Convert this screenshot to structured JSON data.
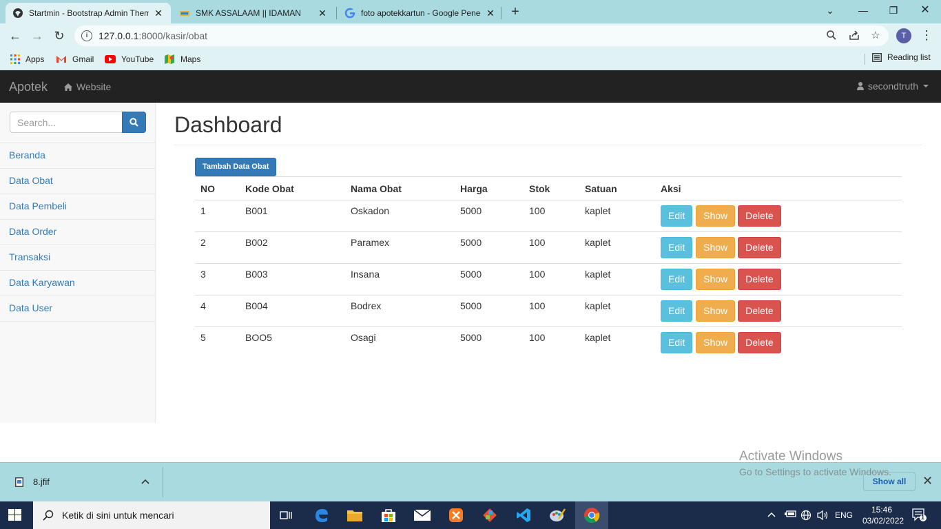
{
  "browser": {
    "tabs": [
      {
        "title": "Startmin - Bootstrap Admin Them",
        "active": true
      },
      {
        "title": "SMK ASSALAAM || IDAMAN",
        "active": false
      },
      {
        "title": "foto apotekkartun - Google Pene",
        "active": false
      }
    ],
    "url": {
      "host": "127.0.0.1",
      "path": ":8000/kasir/obat"
    },
    "profile_initial": "T",
    "bookmarks": [
      "Apps",
      "Gmail",
      "YouTube",
      "Maps"
    ],
    "reading_list": "Reading list"
  },
  "navbar": {
    "brand": "Apotek",
    "website_link": "Website",
    "user": "secondtruth"
  },
  "sidebar": {
    "search_placeholder": "Search...",
    "items": [
      "Beranda",
      "Data Obat",
      "Data Pembeli",
      "Data Order",
      "Transaksi",
      "Data Karyawan",
      "Data User"
    ]
  },
  "main": {
    "title": "Dashboard",
    "add_button": "Tambah Data Obat",
    "table": {
      "headers": [
        "NO",
        "Kode Obat",
        "Nama Obat",
        "Harga",
        "Stok",
        "Satuan",
        "Aksi"
      ],
      "rows": [
        [
          "1",
          "B001",
          "Oskadon",
          "5000",
          "100",
          "kaplet"
        ],
        [
          "2",
          "B002",
          "Paramex",
          "5000",
          "100",
          "kaplet"
        ],
        [
          "3",
          "B003",
          "Insana",
          "5000",
          "100",
          "kaplet"
        ],
        [
          "4",
          "B004",
          "Bodrex",
          "5000",
          "100",
          "kaplet"
        ],
        [
          "5",
          "BOO5",
          "Osagi",
          "5000",
          "100",
          "kaplet"
        ]
      ],
      "actions": {
        "edit": "Edit",
        "show": "Show",
        "delete": "Delete"
      }
    }
  },
  "downloads": {
    "file": "8.jfif",
    "show_all": "Show all"
  },
  "watermark": {
    "line1": "Activate Windows",
    "line2": "Go to Settings to activate Windows."
  },
  "taskbar": {
    "search_placeholder": "Ketik di sini untuk mencari",
    "language": "ENG",
    "time": "15:46",
    "date": "03/02/2022",
    "notification_count": "1"
  },
  "colors": {
    "primary": "#337ab7",
    "info": "#5bc0de",
    "warning": "#f0ad4e",
    "danger": "#d9534f",
    "navbar": "#222222",
    "browser_frame": "#a8dadf"
  }
}
